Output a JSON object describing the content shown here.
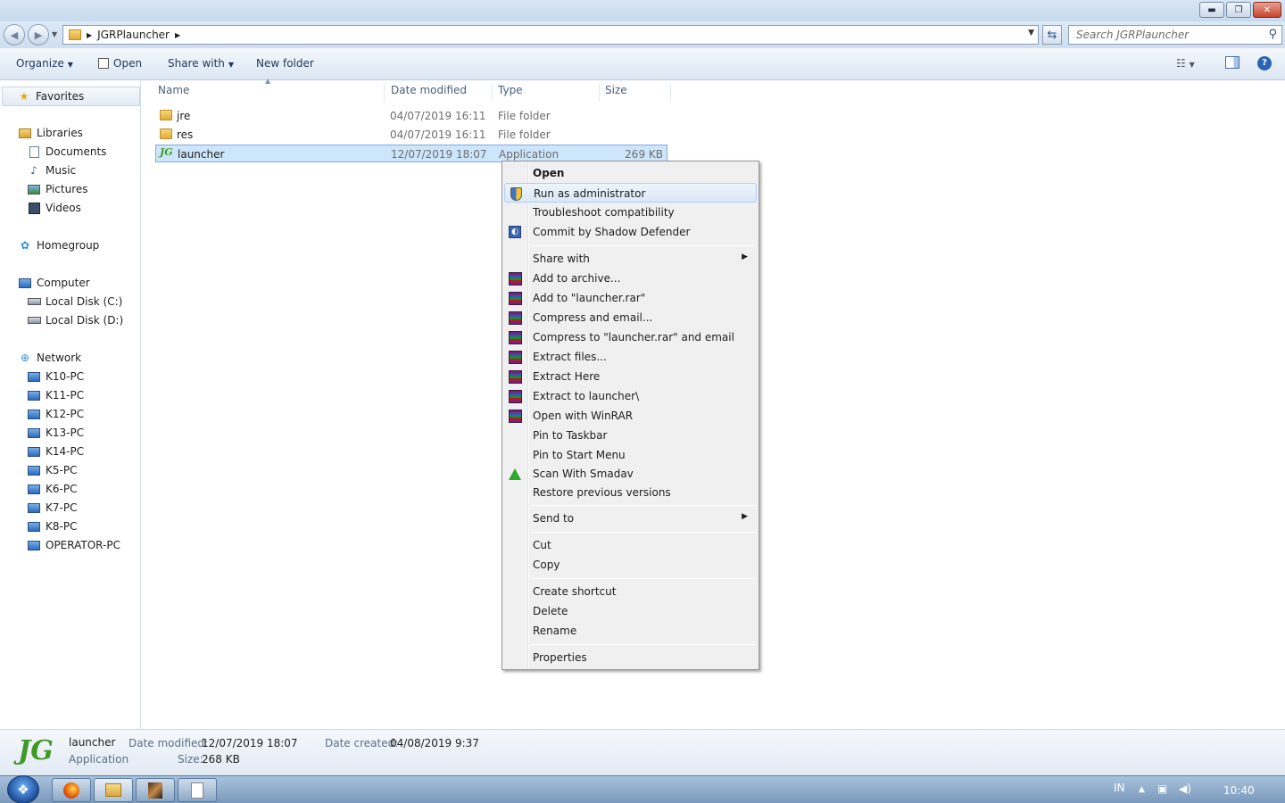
{
  "window": {
    "buttons": {
      "minimize": "▬",
      "maximize": "❐",
      "close": "✕"
    }
  },
  "address": {
    "path_segment": "JGRPlauncher",
    "search_placeholder": "Search JGRPlauncher"
  },
  "toolbar": {
    "organize": "Organize",
    "open": "Open",
    "share_with": "Share with",
    "new_folder": "New folder"
  },
  "nav": {
    "favorites": "Favorites",
    "libraries": "Libraries",
    "documents": "Documents",
    "music": "Music",
    "pictures": "Pictures",
    "videos": "Videos",
    "homegroup": "Homegroup",
    "computer": "Computer",
    "disk_c": "Local Disk (C:)",
    "disk_d": "Local Disk (D:)",
    "network": "Network",
    "network_pcs": [
      "K10-PC",
      "K11-PC",
      "K12-PC",
      "K13-PC",
      "K14-PC",
      "K5-PC",
      "K6-PC",
      "K7-PC",
      "K8-PC",
      "OPERATOR-PC"
    ]
  },
  "columns": {
    "name": "Name",
    "date": "Date modified",
    "type": "Type",
    "size": "Size"
  },
  "files": [
    {
      "name": "jre",
      "date": "04/07/2019 16:11",
      "type": "File folder",
      "size": ""
    },
    {
      "name": "res",
      "date": "04/07/2019 16:11",
      "type": "File folder",
      "size": ""
    },
    {
      "name": "launcher",
      "date": "12/07/2019 18:07",
      "type": "Application",
      "size": "269 KB"
    }
  ],
  "context_menu": {
    "open": "Open",
    "run_admin": "Run as administrator",
    "troubleshoot": "Troubleshoot compatibility",
    "commit_sd": "Commit by Shadow Defender",
    "share_with": "Share with",
    "add_archive": "Add to archive...",
    "add_rar": "Add to \"launcher.rar\"",
    "compress_email": "Compress and email...",
    "compress_rar_email": "Compress to \"launcher.rar\" and email",
    "extract_files": "Extract files...",
    "extract_here": "Extract Here",
    "extract_to": "Extract to launcher\\",
    "open_winrar": "Open with WinRAR",
    "pin_taskbar": "Pin to Taskbar",
    "pin_start": "Pin to Start Menu",
    "scan_smadav": "Scan With Smadav",
    "restore": "Restore previous versions",
    "send_to": "Send to",
    "cut": "Cut",
    "copy": "Copy",
    "create_shortcut": "Create shortcut",
    "delete": "Delete",
    "rename": "Rename",
    "properties": "Properties"
  },
  "details": {
    "name": "launcher",
    "kind": "Application",
    "date_modified_label": "Date modified:",
    "date_modified": "12/07/2019 18:07",
    "size_label": "Size:",
    "size": "268 KB",
    "date_created_label": "Date created:",
    "date_created": "04/08/2019 9:37",
    "icon_text": "JG"
  },
  "taskbar": {
    "lang": "IN",
    "clock": "10:40"
  }
}
